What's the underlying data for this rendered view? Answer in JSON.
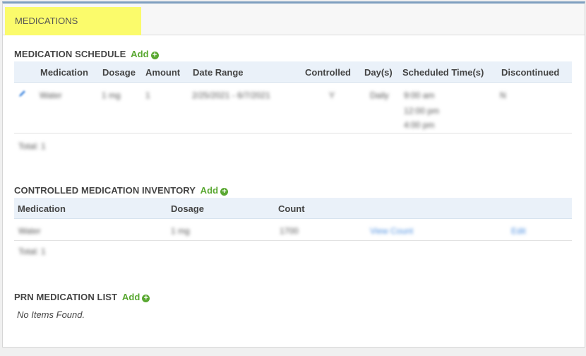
{
  "tab": {
    "label": "MEDICATIONS"
  },
  "schedule": {
    "title": "MEDICATION SCHEDULE",
    "add_label": "Add",
    "columns": [
      "Medication",
      "Dosage",
      "Amount",
      "Date Range",
      "Controlled",
      "Day(s)",
      "Scheduled Time(s)",
      "Discontinued"
    ],
    "row": {
      "medication": "Water",
      "dosage": "1 mg",
      "amount": "1",
      "date_range": "2/25/2021 - 6/7/2021",
      "controlled": "Y",
      "days": "Daily",
      "times": [
        "9:00 am",
        "12:00 pm",
        "4:00 pm"
      ],
      "discontinued": "N"
    },
    "total": "Total: 1"
  },
  "inventory": {
    "title": "CONTROLLED MEDICATION INVENTORY",
    "add_label": "Add",
    "columns": [
      "Medication",
      "Dosage",
      "Count"
    ],
    "row": {
      "medication": "Water",
      "dosage": "1 mg",
      "count": "1700",
      "view_link": "View Count",
      "edit_link": "Edit"
    },
    "total": "Total: 1"
  },
  "prn": {
    "title": "PRN MEDICATION LIST",
    "add_label": "Add",
    "empty": "No Items Found."
  },
  "colors": {
    "tab_highlight": "#fbfb6b",
    "add_green": "#5aa832",
    "header_blue": "#eaf1f9",
    "top_border": "#7f9fbf"
  }
}
